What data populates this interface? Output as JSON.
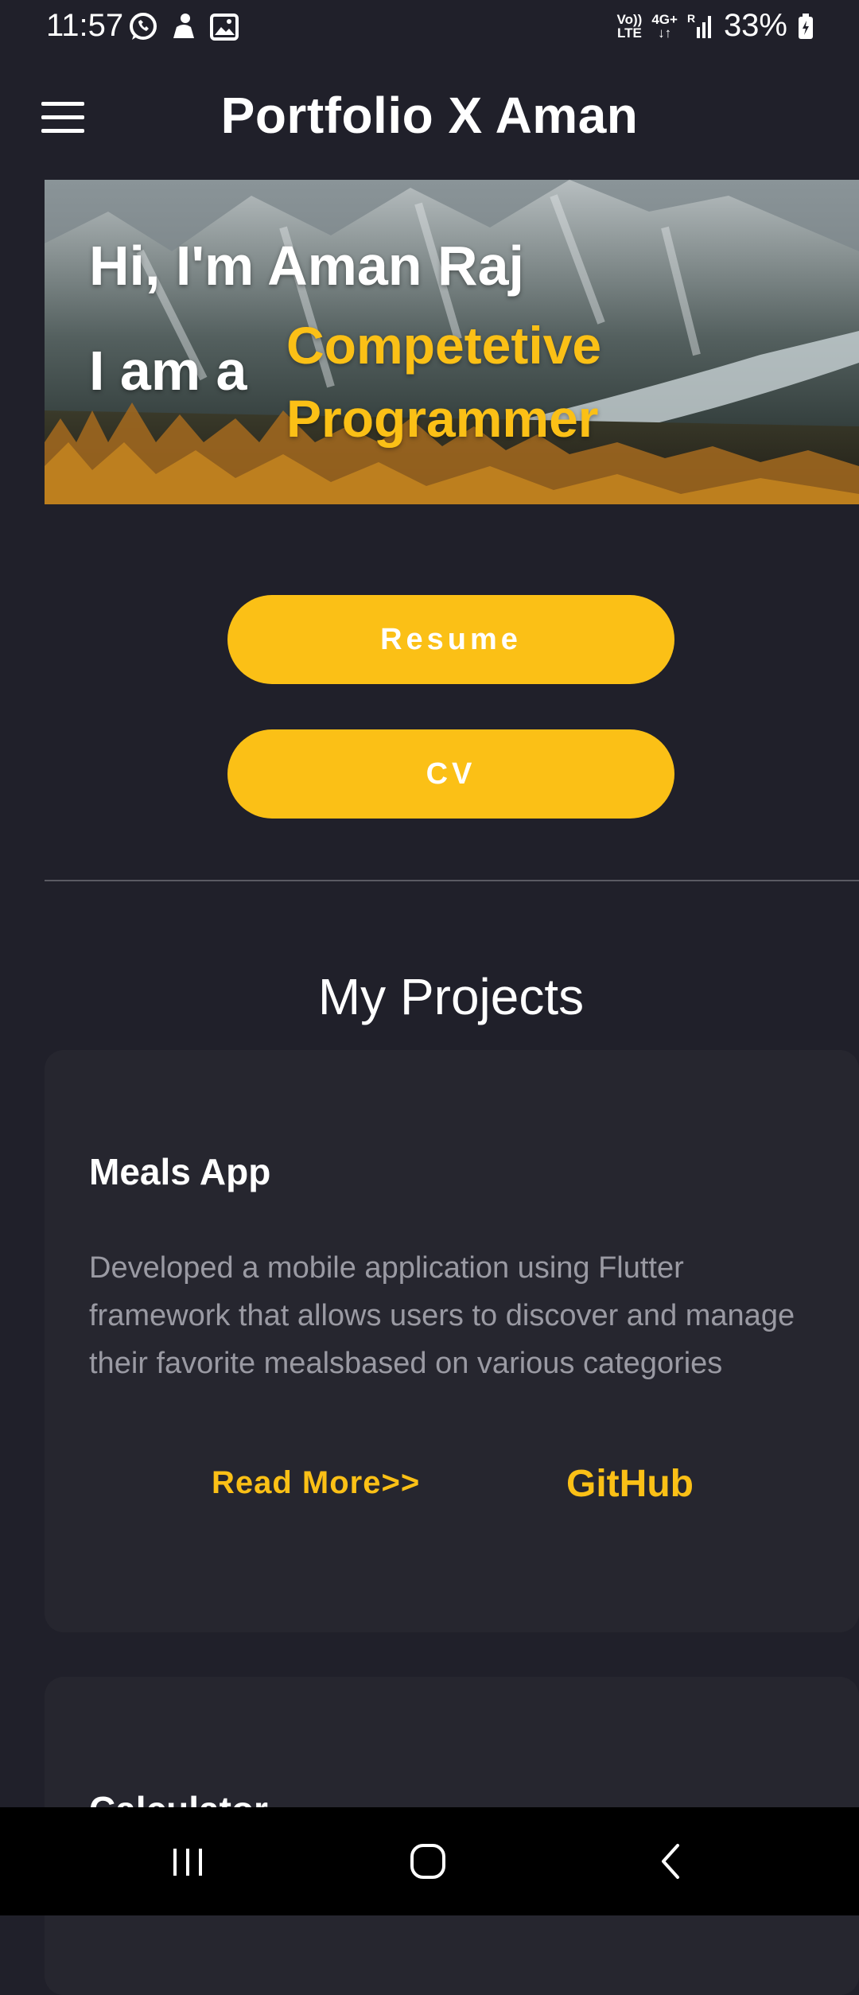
{
  "status": {
    "time": "11:57",
    "network_top": "Vo))",
    "network_bottom": "LTE",
    "data_top": "4G+",
    "battery": "33%"
  },
  "app_bar": {
    "title": "Portfolio X Aman"
  },
  "hero": {
    "greeting": "Hi, I'm Aman Raj",
    "prefix": "I am a",
    "role_line1": "Competetive",
    "role_line2": "Programmer"
  },
  "buttons": {
    "resume": "Resume",
    "cv": "CV"
  },
  "projects": {
    "title": "My Projects",
    "items": [
      {
        "title": "Meals App",
        "description": "Developed a mobile application using Flutter framework that allows users to discover and manage their favorite mealsbased on various categories",
        "read_more": "Read More>>",
        "github": "GitHub"
      },
      {
        "title": "Calculator"
      }
    ]
  },
  "colors": {
    "accent": "#fbc016",
    "background": "#20202a",
    "card": "#26262f"
  }
}
